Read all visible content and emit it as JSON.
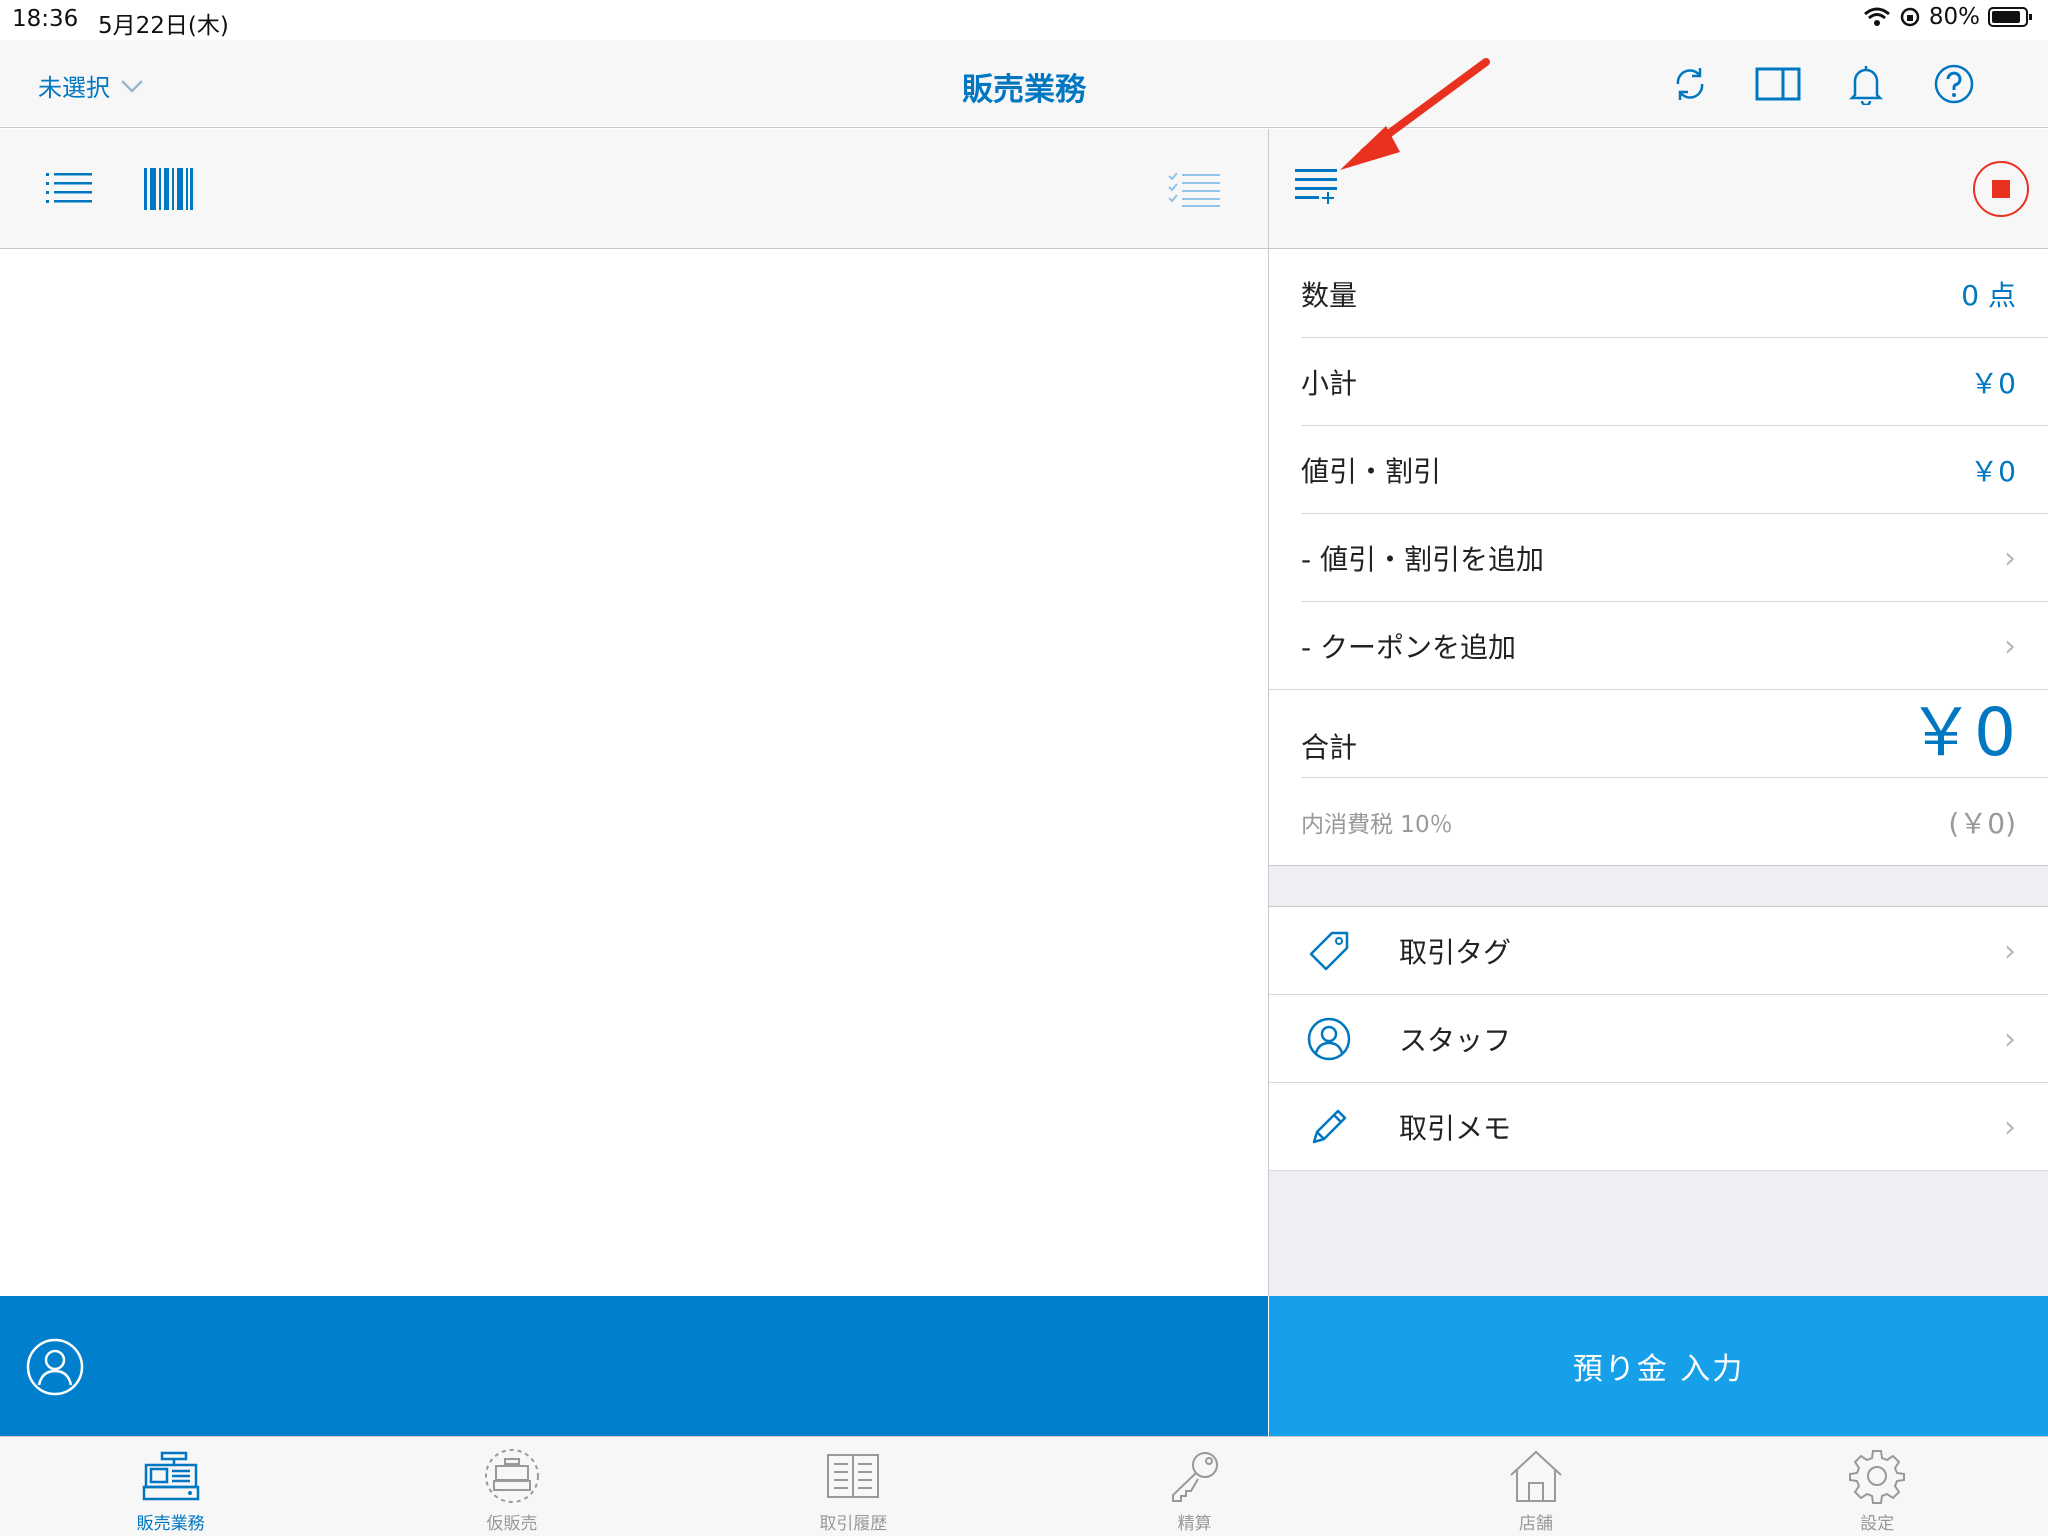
{
  "status_bar": {
    "time": "18:36",
    "date": "5月22日(木)",
    "battery": "80%"
  },
  "navbar": {
    "store_selector": "未選択",
    "title": "販売業務",
    "icons": [
      "sync-icon",
      "split-view-icon",
      "bell-icon",
      "help-icon"
    ]
  },
  "summary": {
    "quantity_label": "数量",
    "quantity_value": "0 点",
    "subtotal_label": "小計",
    "subtotal_value": "￥0",
    "discount_label": "値引・割引",
    "discount_value": "￥0",
    "add_discount_label": "- 値引・割引を追加",
    "add_coupon_label": "- クーポンを追加",
    "total_label": "合計",
    "total_value": "￥0",
    "tax_label": "内消費税 10％",
    "tax_value": "(￥0)"
  },
  "links": [
    {
      "label": "取引タグ",
      "icon": "tag-icon"
    },
    {
      "label": "スタッフ",
      "icon": "staff-icon"
    },
    {
      "label": "取引メモ",
      "icon": "pencil-icon"
    }
  ],
  "bottom": {
    "deposit_button": "預り金 入力"
  },
  "tabs": [
    {
      "label": "販売業務",
      "icon": "register-icon",
      "active": true
    },
    {
      "label": "仮販売",
      "icon": "temp-sale-icon",
      "active": false
    },
    {
      "label": "取引履歴",
      "icon": "history-icon",
      "active": false
    },
    {
      "label": "精算",
      "icon": "key-icon",
      "active": false
    },
    {
      "label": "店舗",
      "icon": "store-icon",
      "active": false
    },
    {
      "label": "設定",
      "icon": "gear-icon",
      "active": false
    }
  ],
  "colors": {
    "accent": "#0077c0",
    "bottom_left": "#0080cc",
    "bottom_right": "#17a0ea",
    "annotation_arrow": "#e8311f",
    "stop_button": "#e8311f"
  }
}
